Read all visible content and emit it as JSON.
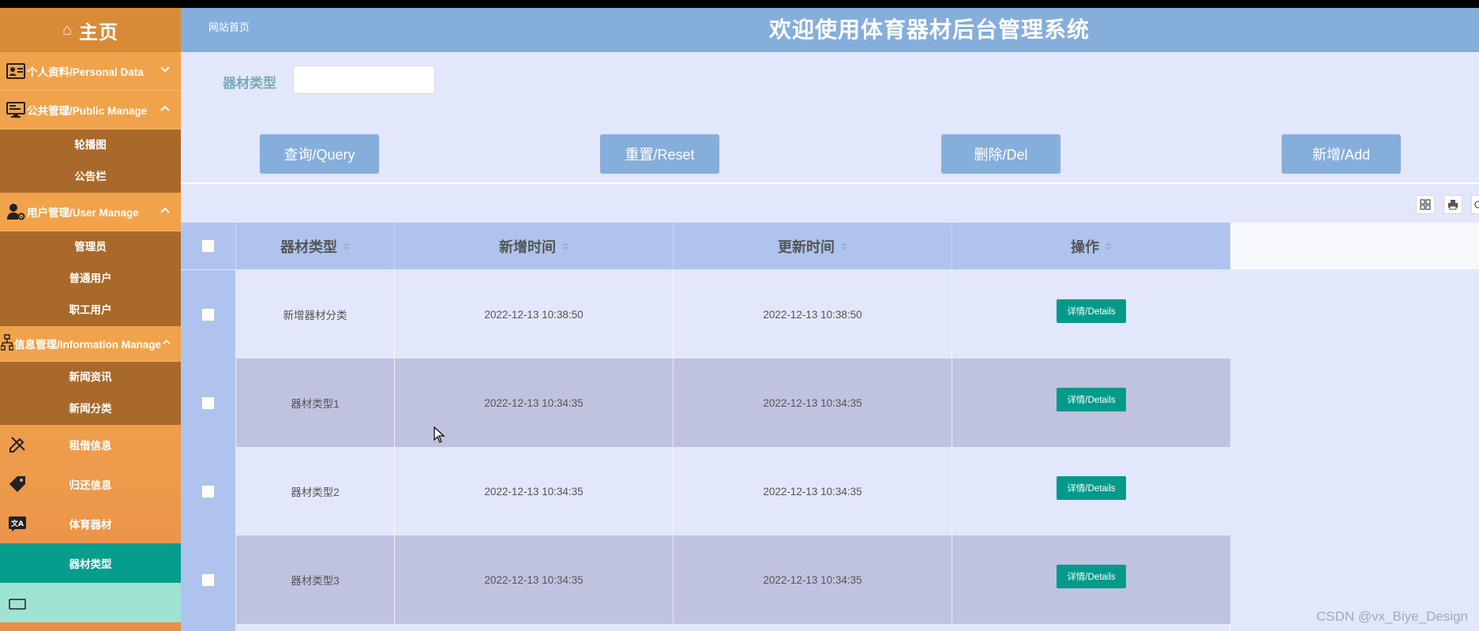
{
  "sidebar": {
    "home_label": "主页",
    "groups": [
      {
        "label": "个人资料/Personal Data",
        "icon": "user-card-icon",
        "expanded": false,
        "items": []
      },
      {
        "label": "公共管理/Public Manage",
        "icon": "monitor-icon",
        "expanded": true,
        "items": [
          "轮播图",
          "公告栏"
        ]
      },
      {
        "label": "用户管理/User Manage",
        "icon": "user-gear-icon",
        "expanded": true,
        "items": [
          "管理员",
          "普通用户",
          "职工用户"
        ]
      },
      {
        "label": "信息管理/Information Manage",
        "icon": "sitemap-icon",
        "expanded": true,
        "items": [
          "新闻资讯",
          "新闻分类"
        ]
      }
    ],
    "single_items": [
      {
        "label": "租借信息",
        "icon": "pencil-ruler-icon"
      },
      {
        "label": "归还信息",
        "icon": "tag-icon"
      },
      {
        "label": "体育器材",
        "icon": "translate-icon"
      },
      {
        "label": "器材类型",
        "icon": "",
        "active": true
      }
    ]
  },
  "header": {
    "breadcrumb": "网站首页",
    "title": "欢迎使用体育器材后台管理系统"
  },
  "search": {
    "label": "器材类型",
    "value": "",
    "placeholder": ""
  },
  "buttons": {
    "query": "查询/Query",
    "reset": "重置/Reset",
    "delete": "删除/Del",
    "add": "新增/Add"
  },
  "table": {
    "columns": [
      "器材类型",
      "新增时间",
      "更新时间",
      "操作"
    ],
    "rows": [
      {
        "type": "新增器材分类",
        "created": "2022-12-13 10:38:50",
        "updated": "2022-12-13 10:38:50",
        "action": "详情/Details"
      },
      {
        "type": "器材类型1",
        "created": "2022-12-13 10:34:35",
        "updated": "2022-12-13 10:34:35",
        "action": "详情/Details"
      },
      {
        "type": "器材类型2",
        "created": "2022-12-13 10:34:35",
        "updated": "2022-12-13 10:34:35",
        "action": "详情/Details"
      },
      {
        "type": "器材类型3",
        "created": "2022-12-13 10:34:35",
        "updated": "2022-12-13 10:34:35",
        "action": "详情/Details"
      }
    ]
  },
  "watermark": "CSDN @vx_Biye_Design",
  "colors": {
    "header_bg": "#86aedb",
    "sidebar_bg": "#f0a34b",
    "submenu_bg": "#a9692a",
    "active_item_bg": "#059d8c",
    "button_bg": "#86aedb",
    "detail_button_bg": "#049a8b",
    "table_header_bg": "#aec4ee",
    "row_alt_bg": "#c0c3e0",
    "page_bg": "#e2e7fb"
  }
}
